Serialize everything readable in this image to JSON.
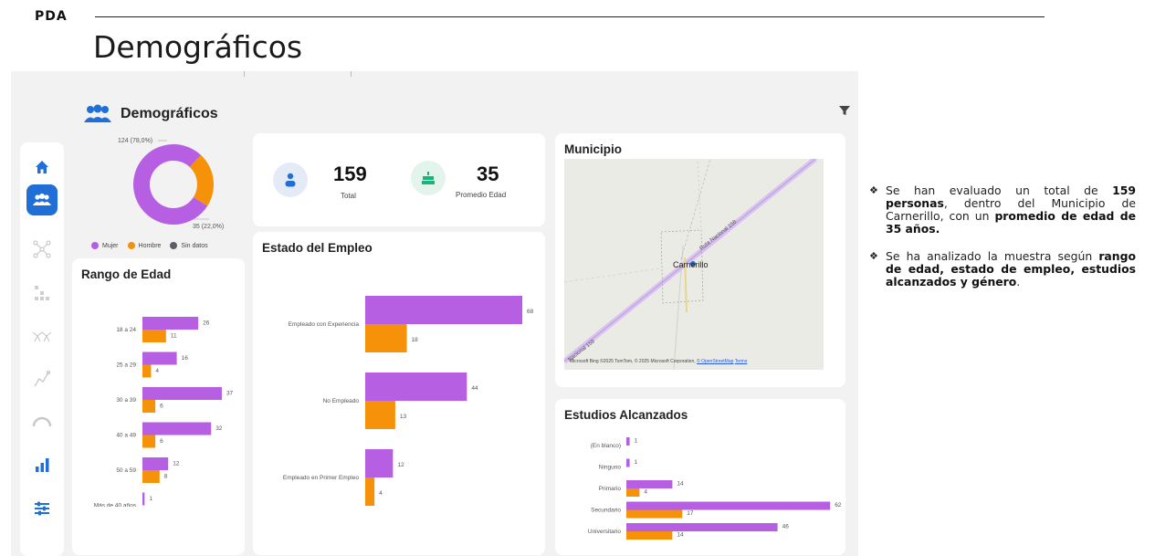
{
  "brand": "PDA",
  "slide_title": "Demográficos",
  "dashboard": {
    "title": "Demográficos",
    "colors": {
      "purple": "#b65fe3",
      "orange": "#f5920a",
      "gray": "#5b5f66",
      "blue": "#1f6fd6"
    },
    "sidebar_icons": [
      "home-icon",
      "people-icon",
      "network-icon",
      "grid-icon",
      "mesh-icon",
      "trend-icon",
      "gauge-icon",
      "bar-chart-icon",
      "sliders-icon"
    ],
    "donut": {
      "label_top": "124 (78,0%)",
      "label_bottom": "35 (22,0%)",
      "legend": [
        "Mujer",
        "Hombre",
        "Sin datos"
      ]
    },
    "kpis": {
      "total_value": "159",
      "total_label": "Total",
      "age_value": "35",
      "age_label": "Promedio Edad"
    },
    "municipio": {
      "title": "Municipio",
      "town": "Carnerillo",
      "road_label_1": "Ruta Nacional 158",
      "road_label_2": "Nacional 158",
      "attribution": "©2025 TomTom, © 2025 Microsoft Corporation,",
      "attribution_link": "© OpenStreetMap",
      "terms": "Terms",
      "ms_logo": "Microsoft Bing"
    },
    "rango": {
      "title": "Rango de Edad"
    },
    "empleo": {
      "title": "Estado del Empleo"
    },
    "estudios": {
      "title": "Estudios Alcanzados"
    }
  },
  "chart_data": [
    {
      "type": "pie",
      "labels": [
        "Mujer",
        "Hombre",
        "Sin datos"
      ],
      "values": [
        124,
        35,
        0
      ],
      "percent_labels": [
        "124 (78,0%)",
        "35 (22,0%)"
      ]
    },
    {
      "type": "bar",
      "title": "Rango de Edad",
      "categories": [
        "18 a 24",
        "25 a 29",
        "30 a 39",
        "40 a 49",
        "50 a 59",
        "Más de 40 años"
      ],
      "series": [
        {
          "name": "Mujer",
          "values": [
            26,
            16,
            37,
            32,
            12,
            1
          ]
        },
        {
          "name": "Hombre",
          "values": [
            11,
            4,
            6,
            6,
            8,
            null
          ]
        }
      ]
    },
    {
      "type": "bar",
      "title": "Estado del Empleo",
      "categories": [
        "Empleado con Experiencia",
        "No Empleado",
        "Empleado en Primer Empleo"
      ],
      "series": [
        {
          "name": "Mujer",
          "values": [
            68,
            44,
            12
          ]
        },
        {
          "name": "Hombre",
          "values": [
            18,
            13,
            4
          ]
        }
      ]
    },
    {
      "type": "bar",
      "title": "Estudios Alcanzados",
      "categories": [
        "(En blanco)",
        "Ninguno",
        "Primario",
        "Secundario",
        "Universitario"
      ],
      "series": [
        {
          "name": "Mujer",
          "values": [
            1,
            1,
            14,
            62,
            46
          ]
        },
        {
          "name": "Hombre",
          "values": [
            null,
            null,
            4,
            17,
            14
          ]
        }
      ]
    }
  ],
  "notes": {
    "p1": [
      {
        "t": "Se han evaluado un total de ",
        "b": false
      },
      {
        "t": "159 personas",
        "b": true
      },
      {
        "t": ", dentro del Municipio de Carnerillo, con un ",
        "b": false
      },
      {
        "t": "promedio de edad de 35 años.",
        "b": true
      }
    ],
    "p2": [
      {
        "t": "Se ha analizado la muestra según ",
        "b": false
      },
      {
        "t": "rango de edad, estado de empleo, estudios alcanzados y género",
        "b": true
      },
      {
        "t": ".",
        "b": false
      }
    ],
    "bullet": "❖"
  }
}
